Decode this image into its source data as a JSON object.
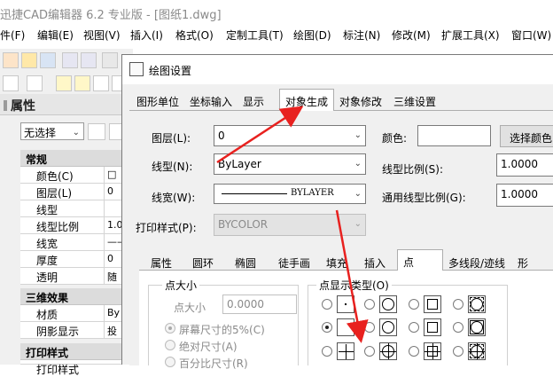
{
  "window": {
    "title": "迅捷CAD编辑器 6.2 专业版 - [图纸1.dwg]"
  },
  "menubar": {
    "items": [
      "件(F)",
      "编辑(E)",
      "视图(V)",
      "插入(I)",
      "格式(O)",
      "定制工具(T)",
      "绘图(D)",
      "标注(N)",
      "修改(M)",
      "扩展工具(X)",
      "窗口(W)"
    ]
  },
  "left_panel": {
    "title": "属性",
    "selection": "无选择",
    "groups": [
      {
        "name": "常规",
        "rows": [
          {
            "key": "颜色(C)",
            "value": "□"
          },
          {
            "key": "图层(L)",
            "value": "0"
          },
          {
            "key": "线型",
            "value": ""
          },
          {
            "key": "线型比例",
            "value": "1.0"
          },
          {
            "key": "线宽",
            "value": "——"
          },
          {
            "key": "厚度",
            "value": "0"
          },
          {
            "key": "透明",
            "value": "随"
          }
        ]
      },
      {
        "name": "三维效果",
        "rows": [
          {
            "key": "材质",
            "value": "By"
          },
          {
            "key": "阴影显示",
            "value": "投"
          }
        ]
      },
      {
        "name": "打印样式",
        "rows": [
          {
            "key": "打印样式",
            "value": ""
          }
        ]
      }
    ]
  },
  "dialog": {
    "title": "绘图设置",
    "tabs": [
      "图形单位",
      "坐标输入",
      "显示",
      "对象生成",
      "对象修改",
      "三维设置"
    ],
    "active_tab": "对象生成",
    "layer": {
      "label": "图层(L):",
      "value": "0"
    },
    "color": {
      "label": "颜色:",
      "button": "选择颜色"
    },
    "linetype": {
      "label": "线型(N):",
      "value": "ByLayer"
    },
    "linetype_scale": {
      "label": "线型比例(S):",
      "value": "1.0000"
    },
    "lineweight": {
      "label": "线宽(W):",
      "value": "BYLAYER"
    },
    "global_scale": {
      "label": "通用线型比例(G):",
      "value": "1.0000"
    },
    "plot_style": {
      "label": "打印样式(P):",
      "value": "BYCOLOR"
    },
    "subtabs": [
      "属性",
      "圆环",
      "椭圆",
      "徒手画",
      "填充",
      "插入",
      "点",
      "多线段/迹线",
      "形"
    ],
    "active_subtab": "点",
    "point_size": {
      "group": "点大小",
      "label": "点大小",
      "value": "0.0000",
      "options": [
        "屏幕尺寸的5%(C)",
        "绝对尺寸(A)",
        "百分比尺寸(R)"
      ]
    },
    "point_display": {
      "group": "点显示类型(O)"
    }
  },
  "colors": {
    "annotation_arrow": "#e8211f",
    "accent": "#0078d7"
  }
}
